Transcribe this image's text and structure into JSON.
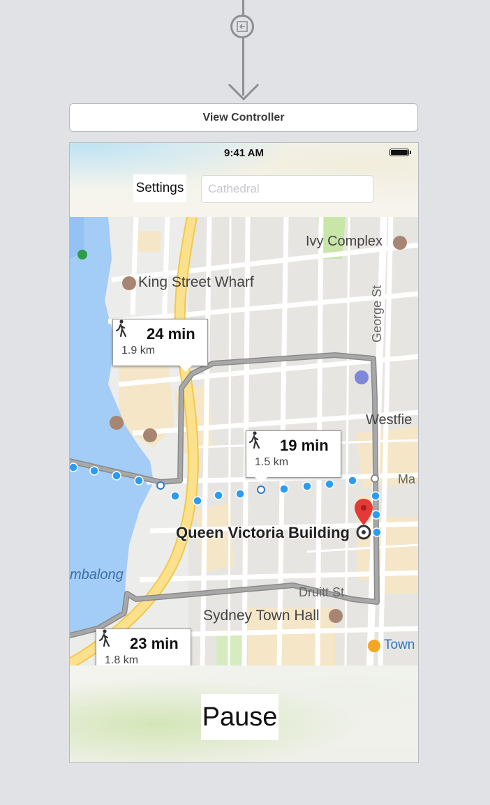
{
  "storyboard": {
    "scene_title": "View Controller"
  },
  "status_bar": {
    "time": "9:41 AM"
  },
  "nav": {
    "settings_label": "Settings",
    "search_placeholder": "Cathedral"
  },
  "map": {
    "labels": {
      "ivy_complex": "Ivy Complex",
      "king_street_wharf": "King Street Wharf",
      "george_st": "George St",
      "westfield": "Westfie",
      "market": "Ma",
      "queen_victoria_building": "Queen Victoria Building",
      "tumbalong": "mbalong",
      "druitt_st": "Druitt St",
      "sydney_town_hall": "Sydney Town Hall",
      "town_hall_station": "Town"
    },
    "route_callouts": [
      {
        "time": "24 min",
        "distance": "1.9 km"
      },
      {
        "time": "19 min",
        "distance": "1.5 km"
      },
      {
        "time": "23 min",
        "distance": "1.8 km"
      }
    ],
    "colors": {
      "water": "#a3ccf6",
      "road": "#ffffff",
      "highway": "#fbe08e",
      "route_gray": "#9b9b9b",
      "route_dots": "#2d9cf0",
      "pin": "#e53935"
    }
  },
  "controls": {
    "pause_label": "Pause"
  },
  "icons": {
    "segue": "embed-segue-icon",
    "walk": "walking-person-icon",
    "pin": "map-pin-icon",
    "landmark": "landmark-icon",
    "station": "train-station-icon"
  }
}
